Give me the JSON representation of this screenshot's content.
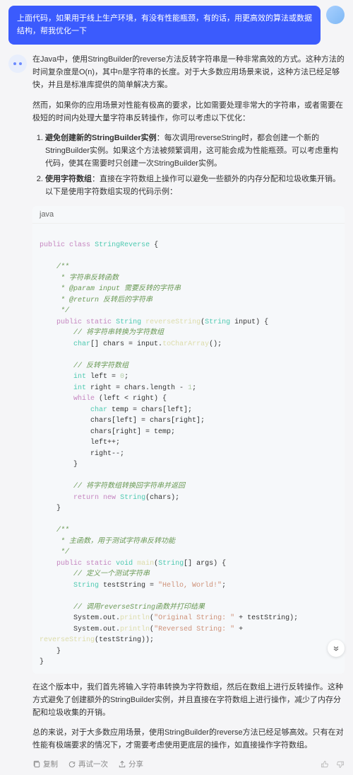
{
  "user": {
    "text": "上面代码，如果用于线上生产环境，有没有性能瓶颈，有的话，用更高效的算法或数据结构，帮我优化一下"
  },
  "bot": {
    "para1": "在Java中，使用StringBuilder的reverse方法反转字符串是一种非常高效的方式。这种方法的时间复杂度是O(n)，其中n是字符串的长度。对于大多数应用场景来说，这种方法已经足够快，并且是标准库提供的简单解决方案。",
    "para2": "然而，如果你的应用场景对性能有极高的要求，比如需要处理非常大的字符串，或者需要在极短的时间内处理大量字符串反转操作，你可以考虑以下优化：",
    "li1a": "避免创建新的StringBuilder实例",
    "li1b": "：每次调用reverseString时，都会创建一个新的StringBuilder实例。如果这个方法被频繁调用，这可能会成为性能瓶颈。可以考虑重构代码，使其在需要时只创建一次StringBuilder实例。",
    "li2a": "使用字符数组",
    "li2b": "：直接在字符数组上操作可以避免一些额外的内存分配和垃圾收集开销。以下是使用字符数组实现的代码示例：",
    "code_lang": "java",
    "code": {
      "l1a": "public",
      "l1b": "class",
      "l1c": "StringReverse",
      "l1d": " {",
      "c1": "    /**",
      "c2": "     * 字符串反转函数",
      "c3a": "     * ",
      "c3b": "@param",
      "c3c": " input 需要反转的字符串",
      "c4a": "     * ",
      "c4b": "@return",
      "c4c": " 反转后的字符串",
      "c5": "     */",
      "l2a": "public",
      "l2b": "static",
      "l2c": "String",
      "l2d": "reverseString",
      "l2e": "String",
      "l2f": " input) {",
      "c6": "        // 将字符串转换为字符数组",
      "l3a": "char",
      "l3b": "[] chars = input.",
      "l3c": "toCharArray",
      "l3d": "();",
      "c7": "        // 反转字符数组",
      "l4a": "int",
      "l4b": " left = ",
      "l4c": "0",
      "l4d": ";",
      "l5a": "int",
      "l5b": " right = chars.length - ",
      "l5c": "1",
      "l5d": ";",
      "l6a": "while",
      "l6b": " (left < right) {",
      "l7a": "char",
      "l7b": " temp = chars[left];",
      "l8": "            chars[left] = chars[right];",
      "l9": "            chars[right] = temp;",
      "l10": "            left++;",
      "l11": "            right--;",
      "l12": "        }",
      "c8": "        // 将字符数组转换回字符串并返回",
      "l13a": "return",
      "l13b": "new",
      "l13c": "String",
      "l13d": "(chars);",
      "l14": "    }",
      "c9": "    /**",
      "c10": "     * 主函数，用于测试字符串反转功能",
      "c11": "     */",
      "l15a": "public",
      "l15b": "static",
      "l15c": "void",
      "l15d": "main",
      "l15e": "String",
      "l15f": "[] args) {",
      "c12": "        // 定义一个测试字符串",
      "l16a": "String",
      "l16b": " testString = ",
      "l16c": "\"Hello, World!\"",
      "l16d": ";",
      "c13": "        // 调用reverseString函数并打印结果",
      "l17a": "        System.out.",
      "l17b": "println",
      "l17c": "(",
      "l17d": "\"Original String: \"",
      "l17e": " + testString);",
      "l18a": "        System.out.",
      "l18b": "println",
      "l18c": "(",
      "l18d": "\"Reversed String: \"",
      "l18e": " + ",
      "l19a": "reverseString",
      "l19b": "(testString));",
      "l20": "    }",
      "l21": "}"
    },
    "para3": "在这个版本中，我们首先将输入字符串转换为字符数组，然后在数组上进行反转操作。这种方式避免了创建额外的StringBuilder实例，并且直接在字符数组上进行操作，减少了内存分配和垃圾收集的开销。",
    "para4": "总的来说，对于大多数应用场景，使用StringBuilder的reverse方法已经足够高效。只有在对性能有极端要求的情况下，才需要考虑使用更底层的操作，如直接操作字符数组。"
  },
  "actions": {
    "copy": "复制",
    "retry": "再试一次",
    "share": "分享"
  }
}
